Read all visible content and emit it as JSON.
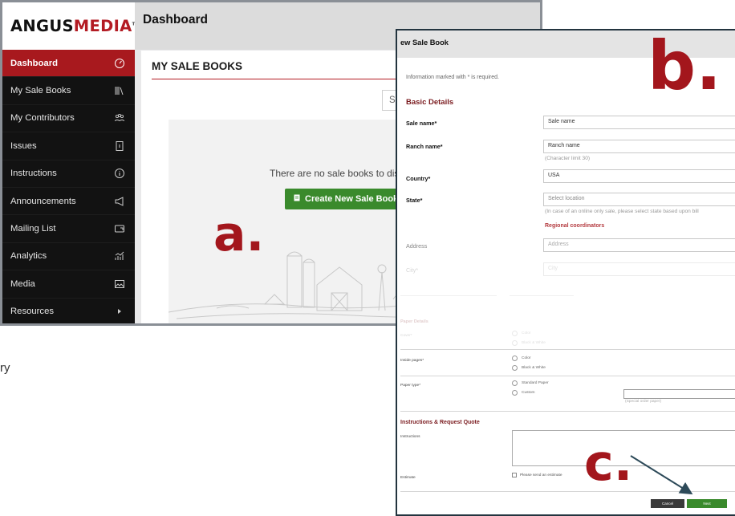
{
  "callouts": {
    "a": "a.",
    "b": "b.",
    "c": "c."
  },
  "brand": {
    "part1": "ANGUS",
    "part2": "MEDIA",
    "tm": "TM"
  },
  "sidebar": {
    "items": [
      {
        "label": "Dashboard",
        "icon": "gauge-icon",
        "active": true
      },
      {
        "label": "My Sale Books",
        "icon": "books-icon"
      },
      {
        "label": "My Contributors",
        "icon": "people-icon"
      },
      {
        "label": "Issues",
        "icon": "document-icon"
      },
      {
        "label": "Instructions",
        "icon": "info-icon"
      },
      {
        "label": "Announcements",
        "icon": "megaphone-icon"
      },
      {
        "label": "Mailing List",
        "icon": "mailbox-icon"
      },
      {
        "label": "Analytics",
        "icon": "analytics-icon"
      },
      {
        "label": "Media",
        "icon": "image-icon"
      },
      {
        "label": "Resources",
        "icon": "caret-right-icon"
      }
    ]
  },
  "dashboard": {
    "title": "Dashboard",
    "card_title": "MY SALE BOOKS",
    "search_placeholder": "Se",
    "empty_text": "There are no sale books to disp",
    "create_button": "Create New Sale Book"
  },
  "form": {
    "title": "ew Sale Book",
    "required_note": "Information marked with * is required.",
    "basic_details": "Basic Details",
    "sale_name_label": "Sale name*",
    "sale_name_placeholder": "Sale name",
    "ranch_name_label": "Ranch name*",
    "ranch_name_placeholder": "Ranch name",
    "ranch_hint": "(Character limit 30)",
    "country_label": "Country*",
    "country_value": "USA",
    "state_label": "State*",
    "state_placeholder": "Select location",
    "state_hint": "(In case of an online only sale, please select state based upon bill",
    "regional_coordinators": "Regional coordinators",
    "address_label": "Address",
    "address_placeholder": "Address",
    "city_label": "City*",
    "city_placeholder": "City",
    "paper_details": "Paper Details",
    "cover_label": "Cover*",
    "inside_label": "Inside pages*",
    "paper_type_label": "Paper type*",
    "opt_color": "Color",
    "opt_bw": "Black & White",
    "opt_standard": "Standard Paper",
    "opt_custom": "Custom",
    "special_hint": "(Special order paper)",
    "instructions_section": "Instructions & Request Quote",
    "instructions_label": "Instructions",
    "estimate_label": "Estimate",
    "estimate_option": "Please send an estimate",
    "cancel_button": "Cancel",
    "next_button": "Next"
  },
  "fragment": "ry",
  "colors": {
    "brand_red": "#b31b23",
    "callout_red": "#a3161c",
    "green": "#3a8a2c",
    "sidebar_bg": "#121212",
    "arrow": "#2d4a59"
  }
}
